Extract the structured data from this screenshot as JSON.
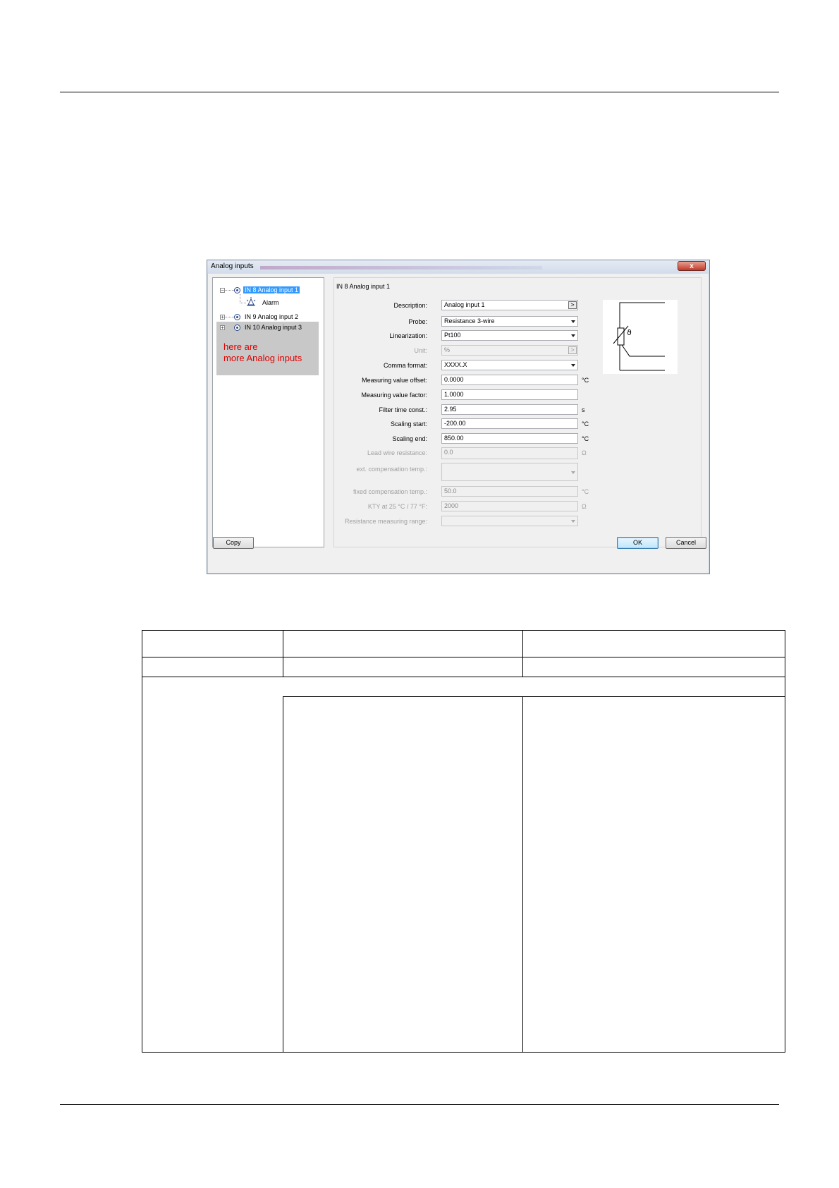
{
  "dialog": {
    "title": "Analog inputs",
    "close_label": "x",
    "tree": {
      "items": [
        {
          "label": "IN 8 Analog input 1",
          "selected": true,
          "expanded": true
        },
        {
          "label": "Alarm"
        },
        {
          "label": "IN 9 Analog input 2"
        },
        {
          "label": "IN 10 Analog input 3"
        }
      ],
      "overlay_line1": "here are",
      "overlay_line2": "more Analog inputs"
    },
    "section_title": "IN 8 Analog input 1",
    "fields": {
      "description": {
        "label": "Description:",
        "value": "Analog input 1",
        "button": ">"
      },
      "probe": {
        "label": "Probe:",
        "value": "Resistance 3-wire"
      },
      "linearization": {
        "label": "Linearization:",
        "value": "Pt100"
      },
      "unit": {
        "label": "Unit:",
        "value": "%",
        "button": ">"
      },
      "comma_format": {
        "label": "Comma format:",
        "value": "XXXX.X"
      },
      "measuring_value_offset": {
        "label": "Measuring value offset:",
        "value": "0.0000",
        "unit": "°C"
      },
      "measuring_value_factor": {
        "label": "Measuring value factor:",
        "value": "1.0000"
      },
      "filter_time_const": {
        "label": "Filter time const.:",
        "value": "2.95",
        "unit": "s"
      },
      "scaling_start": {
        "label": "Scaling start:",
        "value": "-200.00",
        "unit": "°C"
      },
      "scaling_end": {
        "label": "Scaling end:",
        "value": "850.00",
        "unit": "°C"
      },
      "lead_wire_resistance": {
        "label": "Lead wire resistance:",
        "value": "0.0",
        "unit": "Ω"
      },
      "ext_compensation_temp": {
        "label": "ext. compensation temp.:",
        "value": ""
      },
      "fixed_compensation_temp": {
        "label": "fixed compensation temp.:",
        "value": "50.0",
        "unit": "°C"
      },
      "kty": {
        "label": "KTY at 25 °C / 77 °F:",
        "value": "2000",
        "unit": "Ω"
      },
      "resistance_measuring_range": {
        "label": "Resistance measuring range:",
        "value": ""
      }
    },
    "buttons": {
      "copy": "Copy",
      "ok": "OK",
      "cancel": "Cancel"
    }
  }
}
